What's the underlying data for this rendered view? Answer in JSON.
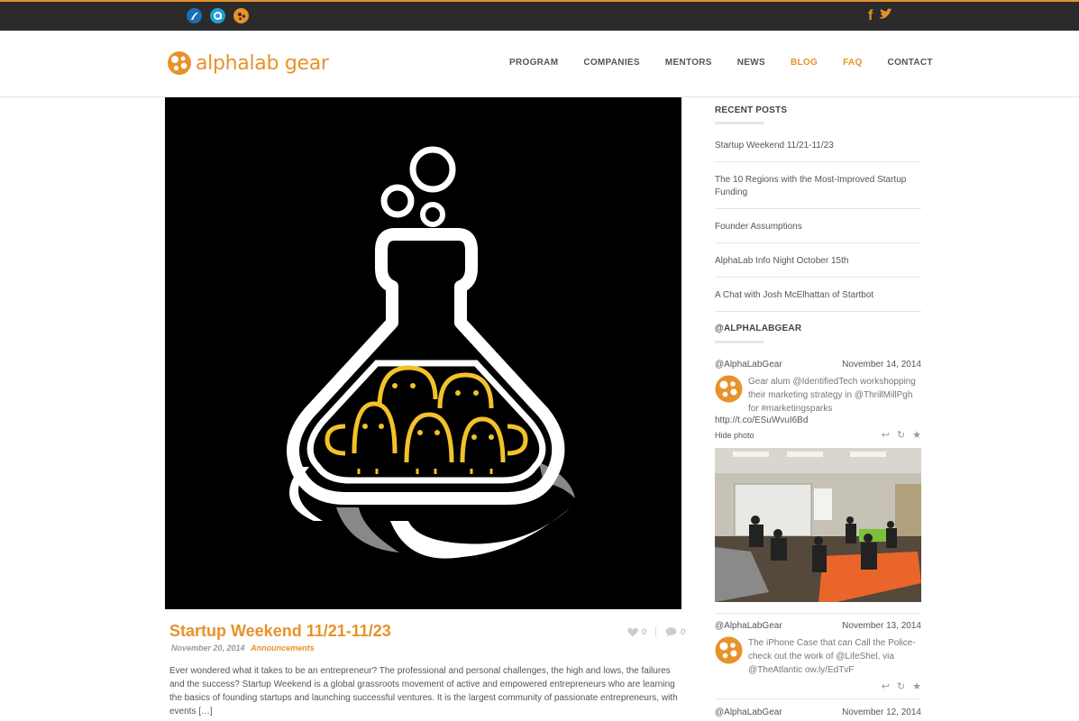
{
  "topbar": {
    "left_icons": [
      "brand-swoosh-icon",
      "alpha-a-icon",
      "alphalab-dots-icon"
    ],
    "social": {
      "facebook": "f",
      "twitter": "twitter-bird-icon"
    },
    "accent": "#e8922a"
  },
  "header": {
    "logo_text_1": "alphalab",
    "logo_text_2": " gear",
    "nav": [
      "PROGRAM",
      "COMPANIES",
      "MENTORS",
      "NEWS",
      "BLOG",
      "FAQ",
      "CONTACT"
    ],
    "nav_active": [
      "BLOG",
      "FAQ"
    ]
  },
  "post": {
    "title": "Startup Weekend 11/21-11/23",
    "date": "November 20, 2014",
    "category": "Announcements",
    "likes": "0",
    "comments": "0",
    "excerpt": "Ever wondered what it takes to be an entrepreneur? The professional and personal challenges, the high and lows, the failures and the success? Startup Weekend is a global grassroots movement of active and empowered entrepreneurs who are learning the basics of founding startups and launching successful ventures. It is the largest community of passionate entrepreneurs, with events […]"
  },
  "sidebar": {
    "recent_heading": "RECENT POSTS",
    "recent_posts": [
      "Startup Weekend 11/21-11/23",
      "The 10 Regions with the Most-Improved Startup Funding",
      "Founder Assumptions",
      "AlphaLab Info Night October 15th",
      "A Chat with Josh McElhattan of Startbot"
    ],
    "twitter_heading": "@ALPHALABGEAR",
    "tweets": [
      {
        "handle": "@AlphaLabGear",
        "date": "November 14, 2014",
        "text": "Gear alum @IdentifiedTech workshopping their marketing strategy in @ThrillMillPgh for #marketingsparks",
        "link": "http://t.co/ESuWvuI6Bd",
        "hide_photo": "Hide photo"
      },
      {
        "handle": "@AlphaLabGear",
        "date": "November 13, 2014",
        "text": "The iPhone Case that can Call the Police- check out the work of @LifeShel, via @TheAtlantic ow.ly/EdTvF"
      },
      {
        "handle": "@AlphaLabGear",
        "date": "November 12, 2014"
      }
    ]
  }
}
